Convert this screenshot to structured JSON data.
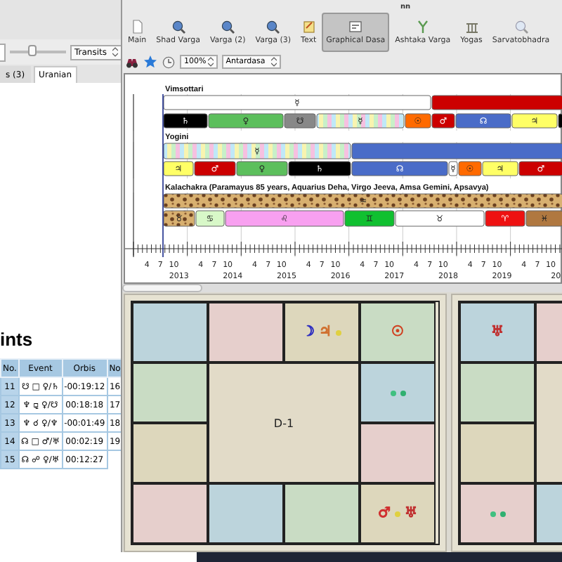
{
  "left_window": {
    "slider": {
      "level": 0.4
    },
    "dropdown": "Transits",
    "tabs": [
      {
        "label": "s (3)",
        "selected": false
      },
      {
        "label": "Uranian",
        "selected": true
      }
    ],
    "heading": "ints",
    "table": {
      "columns": [
        "No.",
        "Event",
        "Orbis",
        "No"
      ],
      "rows": [
        [
          "11",
          "☋ □ ♀/♄",
          "-00:19:12",
          "16"
        ],
        [
          "12",
          "♆ ⚼ ♀/☋",
          "00:18:18",
          "17"
        ],
        [
          "13",
          "♆ ☌ ♀/♆",
          "-00:01:49",
          "18"
        ],
        [
          "14",
          "☊ □ ♂/♅",
          "00:02:19",
          "19"
        ],
        [
          "15",
          "☊ ☍ ♀/♅",
          "00:12:27"
        ]
      ]
    }
  },
  "right_window": {
    "title": "nn",
    "toolbar": [
      {
        "label": "Main",
        "kind": "page",
        "selected": false
      },
      {
        "label": "Shad Varga",
        "kind": "magnifier",
        "selected": false
      },
      {
        "label": "Varga (2)",
        "kind": "magnifier",
        "selected": false
      },
      {
        "label": "Varga (3)",
        "kind": "magnifier",
        "selected": false
      },
      {
        "label": "Text",
        "kind": "notepad",
        "selected": false
      },
      {
        "label": "Graphical Dasa",
        "kind": "chart",
        "selected": true
      },
      {
        "label": "Ashtaka Varga",
        "kind": "fork",
        "selected": false
      },
      {
        "label": "Yogas",
        "kind": "columns",
        "selected": false
      },
      {
        "label": "Sarvatobhadra",
        "kind": "magnifier-light",
        "selected": false
      }
    ],
    "zoom": "100%",
    "dasa_level": "Antardasa",
    "dasa_systems": [
      {
        "name": "Vimsottari",
        "periods": [
          {
            "glyph": "☿",
            "color": "#ffffff",
            "kind": "solid"
          },
          {
            "color": "#cc0000",
            "kind": "solid"
          }
        ],
        "sub_periods": [
          {
            "glyph": "♄",
            "color": "#000000",
            "kind": "solid"
          },
          {
            "glyph": "♀",
            "color": "#5cbf5c",
            "kind": "solid"
          },
          {
            "glyph": "☋",
            "color": "#888888",
            "kind": "solid"
          },
          {
            "glyph": "☿",
            "kind": "striped"
          },
          {
            "glyph": "☉",
            "color": "#ff6a00",
            "kind": "solid"
          },
          {
            "glyph": "♂",
            "color": "#cc0000",
            "kind": "solid"
          },
          {
            "glyph": "☊",
            "color": "#4a6cc8",
            "kind": "solid"
          },
          {
            "glyph": "♃",
            "color": "#ffff66",
            "kind": "solid"
          },
          {
            "color": "#000000",
            "kind": "solid"
          }
        ]
      },
      {
        "name": "Yogini",
        "periods": [
          {
            "glyph": "☿",
            "kind": "striped"
          },
          {
            "color": "#4a6cc8",
            "kind": "solid"
          }
        ],
        "sub_periods": [
          {
            "glyph": "♃",
            "color": "#ffff66",
            "kind": "solid"
          },
          {
            "glyph": "♂",
            "color": "#cc0000",
            "kind": "solid"
          },
          {
            "glyph": "♀",
            "color": "#5cbf5c",
            "kind": "solid"
          },
          {
            "glyph": "♄",
            "color": "#000000",
            "kind": "solid"
          },
          {
            "glyph": "☊",
            "color": "#4a6cc8",
            "kind": "solid"
          },
          {
            "glyph": "☿",
            "color": "#ffffff",
            "kind": "solid"
          },
          {
            "glyph": "☉",
            "color": "#ff6a00",
            "kind": "solid"
          },
          {
            "glyph": "♃",
            "color": "#ffff66",
            "kind": "solid"
          },
          {
            "glyph": "♂",
            "color": "#cc0000",
            "kind": "solid"
          }
        ]
      },
      {
        "name": "Kalachakra (Paramayus 85 years, Aquarius Deha, Virgo Jeeva, Amsa Gemini, Apsavya)",
        "periods": [
          {
            "glyph": "♒",
            "kind": "leopard"
          }
        ],
        "sub_periods": [
          {
            "glyph": "♉",
            "kind": "leopard"
          },
          {
            "glyph": "♋",
            "color": "#d8f8c8",
            "kind": "solid"
          },
          {
            "glyph": "♌",
            "color": "#f8a0f0",
            "kind": "solid"
          },
          {
            "glyph": "♊",
            "color": "#10c030",
            "kind": "solid"
          },
          {
            "glyph": "♉",
            "color": "#ffffff",
            "kind": "solid"
          },
          {
            "glyph": "♈",
            "color": "#ee1111",
            "kind": "solid"
          },
          {
            "glyph": "♓",
            "color": "#b07840",
            "kind": "solid"
          }
        ]
      }
    ],
    "axis": [
      {
        "months": [
          "4",
          "7",
          "10"
        ],
        "year": "2013"
      },
      {
        "months": [
          "4",
          "7",
          "10"
        ],
        "year": "2014"
      },
      {
        "months": [
          "4",
          "7",
          "10"
        ],
        "year": "2015"
      },
      {
        "months": [
          "4",
          "7",
          "10"
        ],
        "year": "2016"
      },
      {
        "months": [
          "4",
          "7",
          "10"
        ],
        "year": "2017"
      },
      {
        "months": [
          "4",
          "7",
          "10"
        ],
        "year": "2018"
      },
      {
        "months": [
          "4",
          "7",
          "10"
        ],
        "year": "2019"
      },
      {
        "months": [
          "4",
          "7",
          "10"
        ],
        "year": "20"
      }
    ],
    "charts": [
      {
        "label": "D-1",
        "houses": {
          "house_3": [
            {
              "glyph": "☽",
              "color": "#3030c0"
            },
            {
              "glyph": "♃",
              "color": "#d07030"
            },
            {
              "kind": "dot",
              "color": "#e0d040"
            }
          ],
          "house_4": [
            {
              "glyph": "☉",
              "color": "#d04020"
            }
          ],
          "house_5": [
            {
              "kind": "dot",
              "color": "#40c080"
            },
            {
              "kind": "dot",
              "color": "#30b070"
            }
          ],
          "house_7": [
            {
              "glyph": "♂",
              "color": "#d03030"
            },
            {
              "kind": "dot",
              "color": "#e0d040"
            },
            {
              "glyph": "♅",
              "color": "#c03030"
            }
          ]
        }
      },
      {
        "houses": {
          "house_1": [
            {
              "glyph": "♅",
              "color": "#c03030"
            }
          ],
          "house_10": [
            {
              "kind": "dot",
              "color": "#40c080"
            },
            {
              "kind": "dot",
              "color": "#30b070"
            }
          ]
        }
      }
    ]
  }
}
